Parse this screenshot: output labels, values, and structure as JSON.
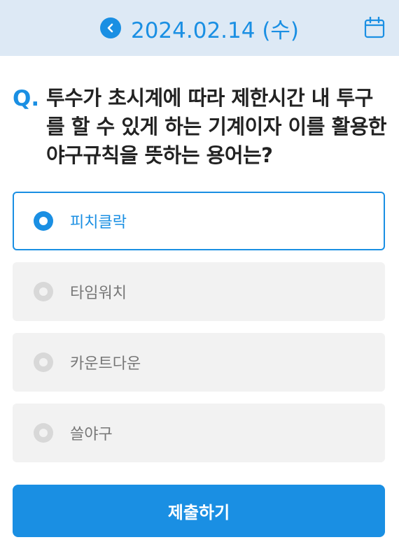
{
  "header": {
    "date": "2024.02.14 (수)",
    "back_icon": "chevron-left-circle-icon",
    "calendar_icon": "calendar-icon"
  },
  "question": {
    "marker": "Q.",
    "text": "투수가 초시계에 따라 제한시간 내 투구를 할 수 있게 하는 기계이자 이를 활용한 야구규칙을 뜻하는 용어는?"
  },
  "options": [
    {
      "label": "피치클락",
      "selected": true
    },
    {
      "label": "타임워치",
      "selected": false
    },
    {
      "label": "카운트다운",
      "selected": false
    },
    {
      "label": "쓸야구",
      "selected": false
    }
  ],
  "submit": {
    "label": "제출하기"
  },
  "colors": {
    "accent": "#1a8fe3",
    "header_bg": "#dde9f5",
    "option_bg": "#f2f2f2"
  }
}
